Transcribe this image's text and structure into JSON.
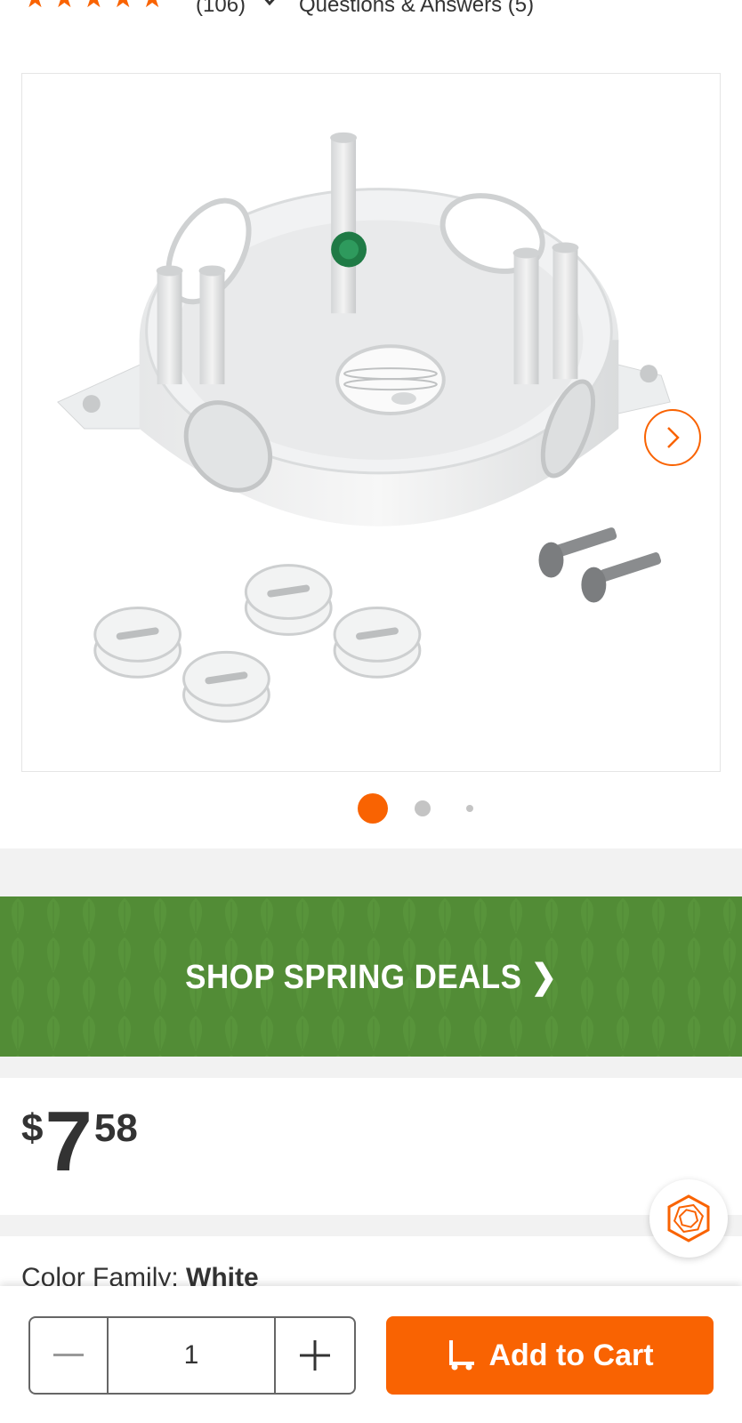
{
  "ratings": {
    "stars": 5,
    "review_count": "(106)",
    "qa_link": "Questions & Answers (5)"
  },
  "gallery": {
    "image_alt": "White round weatherproof outdoor electrical box with closure plugs and screws",
    "next_icon": "chevron-right-icon",
    "dots_count": 3,
    "active_dot": 1
  },
  "promo": {
    "text": "SHOP SPRING DEALS ❯"
  },
  "price": {
    "symbol": "$",
    "dollars": "7",
    "cents": "58"
  },
  "color_family": {
    "label": "Color Family: ",
    "value": "White"
  },
  "cart_bar": {
    "quantity": "1",
    "add_to_cart_label": "Add to Cart"
  },
  "colors": {
    "brand_orange": "#f96302",
    "promo_green": "#528c36"
  }
}
